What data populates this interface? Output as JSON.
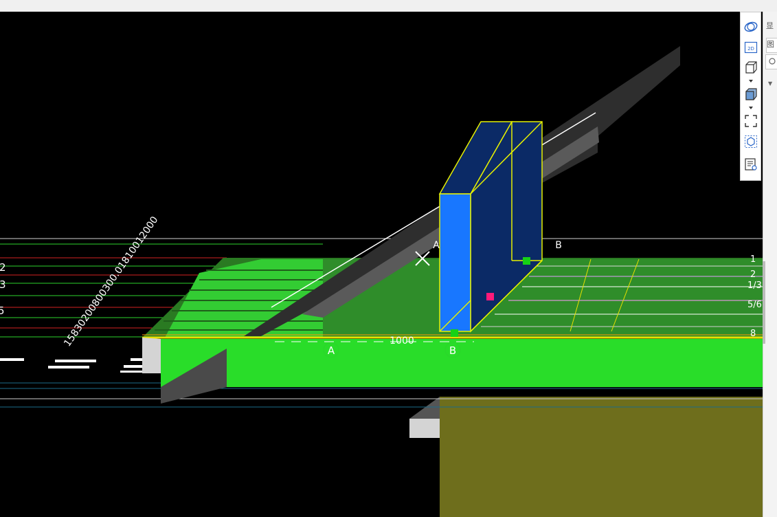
{
  "toolbar": {
    "buttons": [
      {
        "name": "orbit-icon",
        "label": ""
      },
      {
        "name": "view-2d-icon",
        "label": "2D"
      },
      {
        "name": "view-3d-box-icon",
        "label": ""
      },
      {
        "name": "shaded-box-icon",
        "label": ""
      },
      {
        "name": "fit-view-icon",
        "label": ""
      },
      {
        "name": "section-box-icon",
        "label": ""
      },
      {
        "name": "properties-view-icon",
        "label": ""
      }
    ]
  },
  "right_panel": {
    "tab1": "显",
    "tab2": "图"
  },
  "viewport": {
    "axis_labels": {
      "a_bottom": "A",
      "b_bottom": "B",
      "a_top": "A",
      "b_top": "B"
    },
    "dimension_text": "1000",
    "left_row_numbers": [
      "2",
      "3",
      "5"
    ],
    "right_row_numbers": [
      "1",
      "2",
      "1/3",
      "5/6",
      "8"
    ],
    "diagonal_label": "15830200800300.01810012000"
  }
}
